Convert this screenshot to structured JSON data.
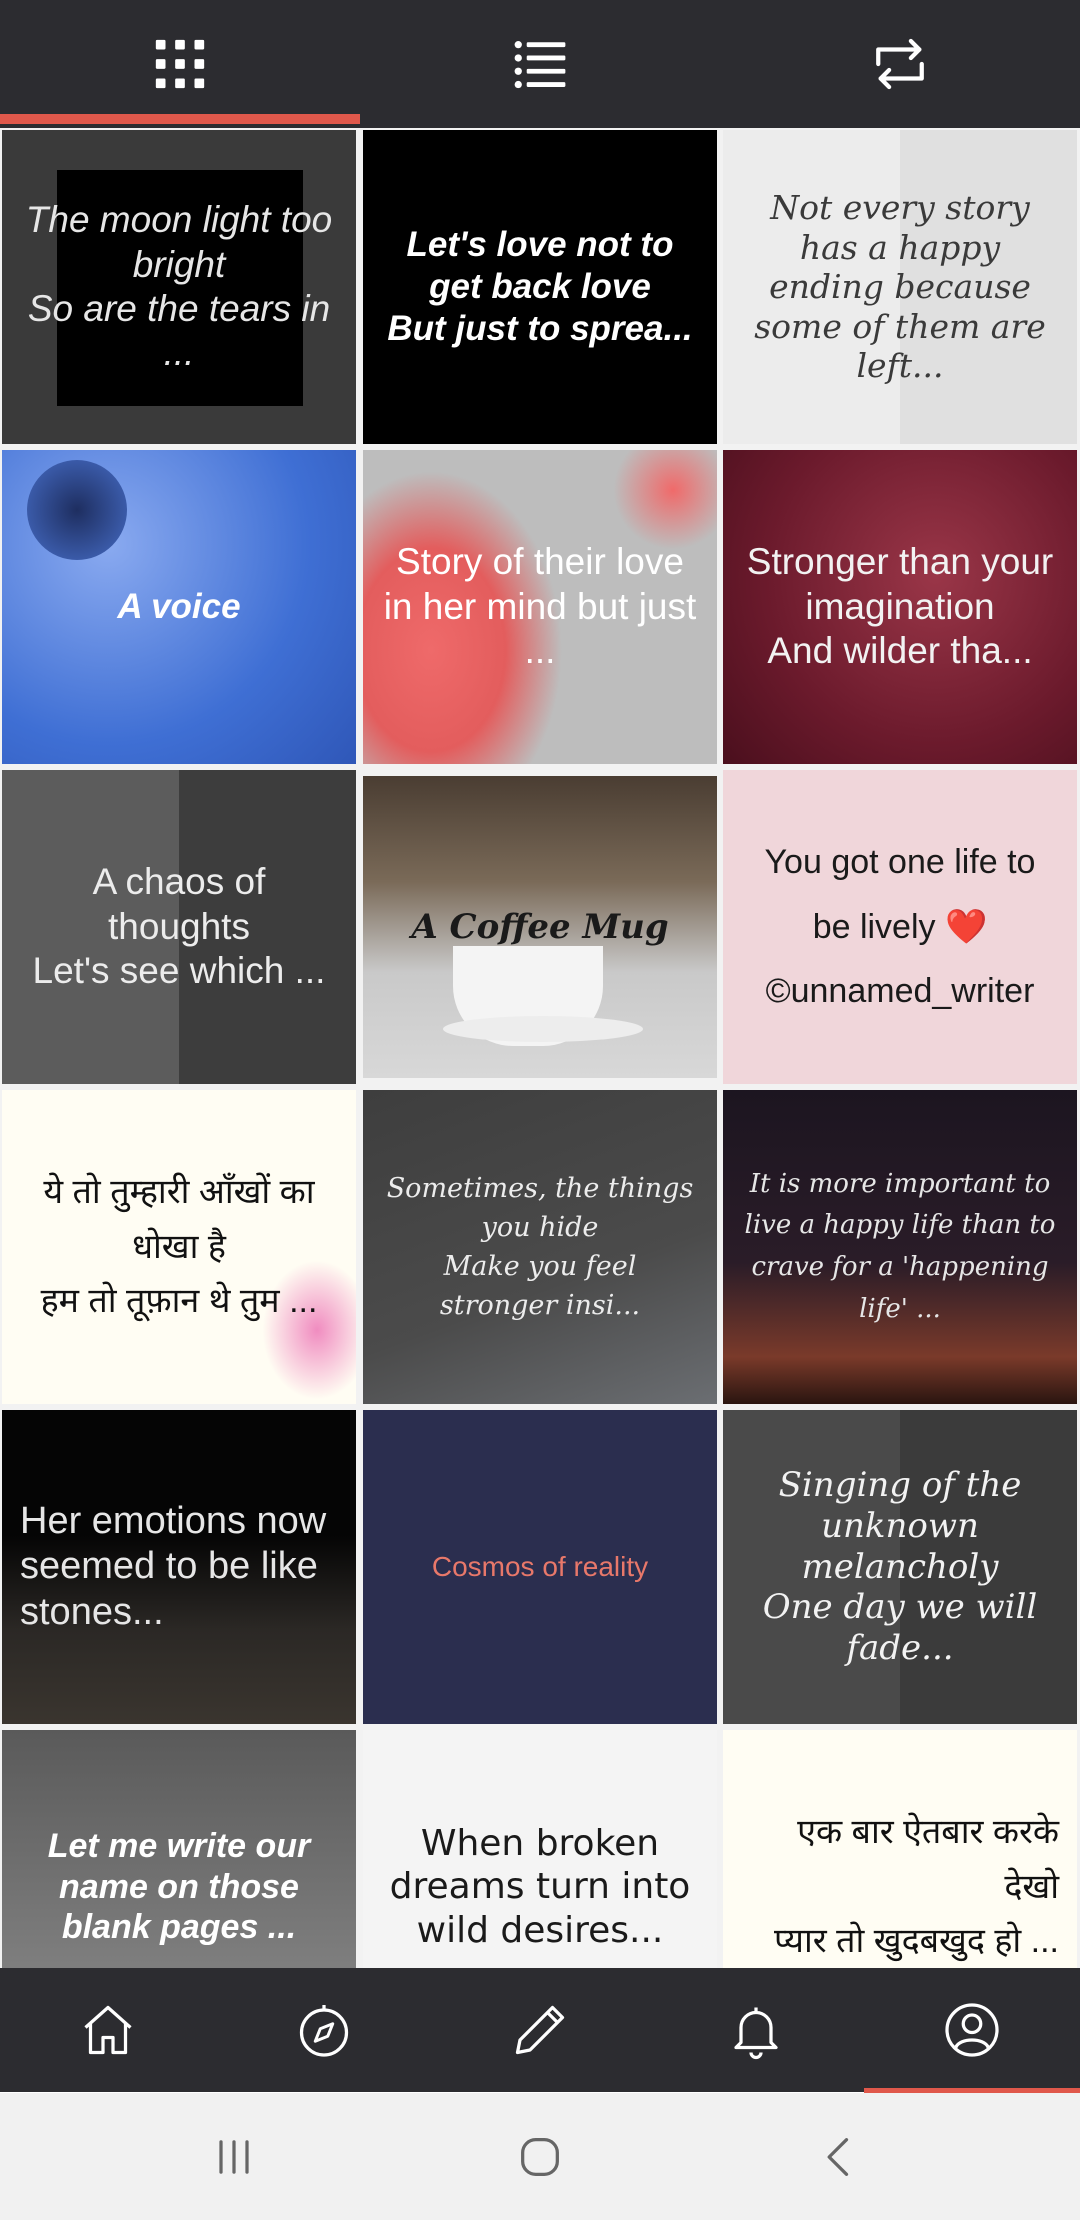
{
  "top_tabs": [
    {
      "name": "grid-view-tab",
      "icon": "grid-icon",
      "active": true
    },
    {
      "name": "list-view-tab",
      "icon": "list-icon",
      "active": false
    },
    {
      "name": "repost-tab",
      "icon": "repost-icon",
      "active": false
    }
  ],
  "accent_color": "#e0584b",
  "bar_color": "#2c2c30",
  "posts": [
    {
      "text": "The moon light too bright\nSo are the tears in ..."
    },
    {
      "text": "Let's love not to get back love\nBut just to sprea..."
    },
    {
      "text": "Not every story has a happy ending because some of them are left..."
    },
    {
      "text": "A voice"
    },
    {
      "text": "Story of their love in her mind but just ..."
    },
    {
      "text": "Stronger than your imagination\nAnd wilder tha..."
    },
    {
      "text": "A chaos of thoughts\nLet's see which ..."
    },
    {
      "text": "A Coffee Mug"
    },
    {
      "text": "You got one life to be lively ❤️\n©unnamed_writer"
    },
    {
      "text": "ये तो तुम्हारी आँखों का धोखा है\nहम तो तूफ़ान थे तुम ..."
    },
    {
      "text": "Sometimes, the things you hide\nMake you feel stronger insi..."
    },
    {
      "text": "It is more important to live a happy life  than to crave for a 'happening life' ..."
    },
    {
      "text": "Her emotions now seemed to be like stones..."
    },
    {
      "text": "Cosmos of reality"
    },
    {
      "text": "Singing of the unknown melancholy\nOne day we will fade..."
    },
    {
      "text": "Let me write our name on those blank pages ..."
    },
    {
      "text": "When broken dreams turn into wild desires..."
    },
    {
      "text": "एक बार ऐतबार करके देखो\nप्यार तो खुदबखुद हो ..."
    }
  ],
  "bottom_nav": [
    {
      "name": "home",
      "icon": "home-icon"
    },
    {
      "name": "explore",
      "icon": "compass-icon"
    },
    {
      "name": "write",
      "icon": "pen-icon"
    },
    {
      "name": "notifications",
      "icon": "bell-icon"
    },
    {
      "name": "profile",
      "icon": "user-icon",
      "active": true
    }
  ],
  "system_nav": [
    {
      "name": "recents",
      "icon": "recents-icon"
    },
    {
      "name": "home",
      "icon": "home-circle-icon"
    },
    {
      "name": "back",
      "icon": "back-icon"
    }
  ]
}
